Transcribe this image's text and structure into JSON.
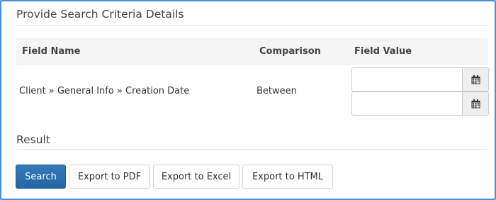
{
  "criteria": {
    "title": "Provide Search Criteria Details",
    "columns": {
      "field_name": "Field Name",
      "comparison": "Comparison",
      "field_value": "Field Value"
    },
    "rows": [
      {
        "field_name": "Client » General Info » Creation Date",
        "comparison": "Between",
        "value_from": "",
        "value_to": ""
      }
    ]
  },
  "result": {
    "title": "Result",
    "buttons": {
      "search": "Search",
      "export_pdf": "Export to PDF",
      "export_excel": "Export to Excel",
      "export_html": "Export to HTML"
    }
  },
  "icons": {
    "calendar": "calendar-icon"
  },
  "colors": {
    "frame_border": "#4a90d9",
    "primary_button": "#2a6ab2",
    "header_bg": "#f5f5f5"
  }
}
